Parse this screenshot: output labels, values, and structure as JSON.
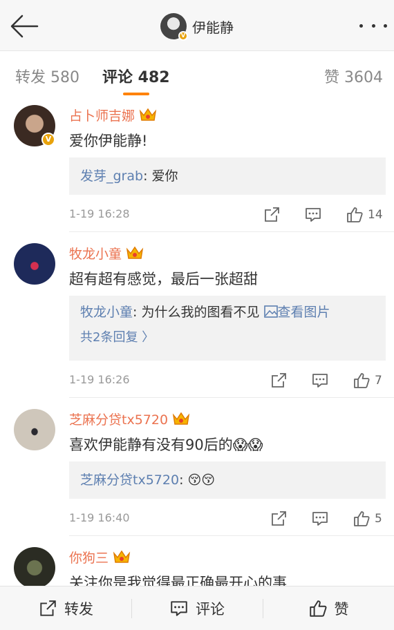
{
  "header": {
    "title": "伊能静",
    "verified_mark": "V"
  },
  "tabs": {
    "repost": "转发 580",
    "comments": "评论 482",
    "likes": "赞 3604"
  },
  "comments": [
    {
      "author": "占卜师吉娜",
      "verified_mark": "V",
      "text": "爱你伊能静!",
      "replies": [
        {
          "user": "发芽_grab",
          "text": ": 爱你"
        }
      ],
      "time": "1-19 16:28",
      "likes": "14"
    },
    {
      "author": "牧龙小童",
      "text": "超有超有感觉，最后一张超甜",
      "replies": [
        {
          "user": "牧龙小童",
          "text": ": 为什么我的图看不见 ",
          "link": "查看图片"
        }
      ],
      "more_replies": "共2条回复 〉",
      "time": "1-19 16:26",
      "likes": "7"
    },
    {
      "author": "芝麻分贷tx5720",
      "text": "喜欢伊能静有没有90后的😱😱",
      "replies": [
        {
          "user": "芝麻分贷tx5720",
          "text": ": 😚😚"
        }
      ],
      "time": "1-19 16:40",
      "likes": "5"
    },
    {
      "author": "你狗三",
      "text": "关注你是我觉得最正确最开心的事"
    }
  ],
  "bottom_bar": {
    "repost": "转发",
    "comment": "评论",
    "like": "赞"
  },
  "colors": {
    "accent": "#ff8200",
    "name": "#eb7350",
    "link": "#5d7fb0"
  }
}
